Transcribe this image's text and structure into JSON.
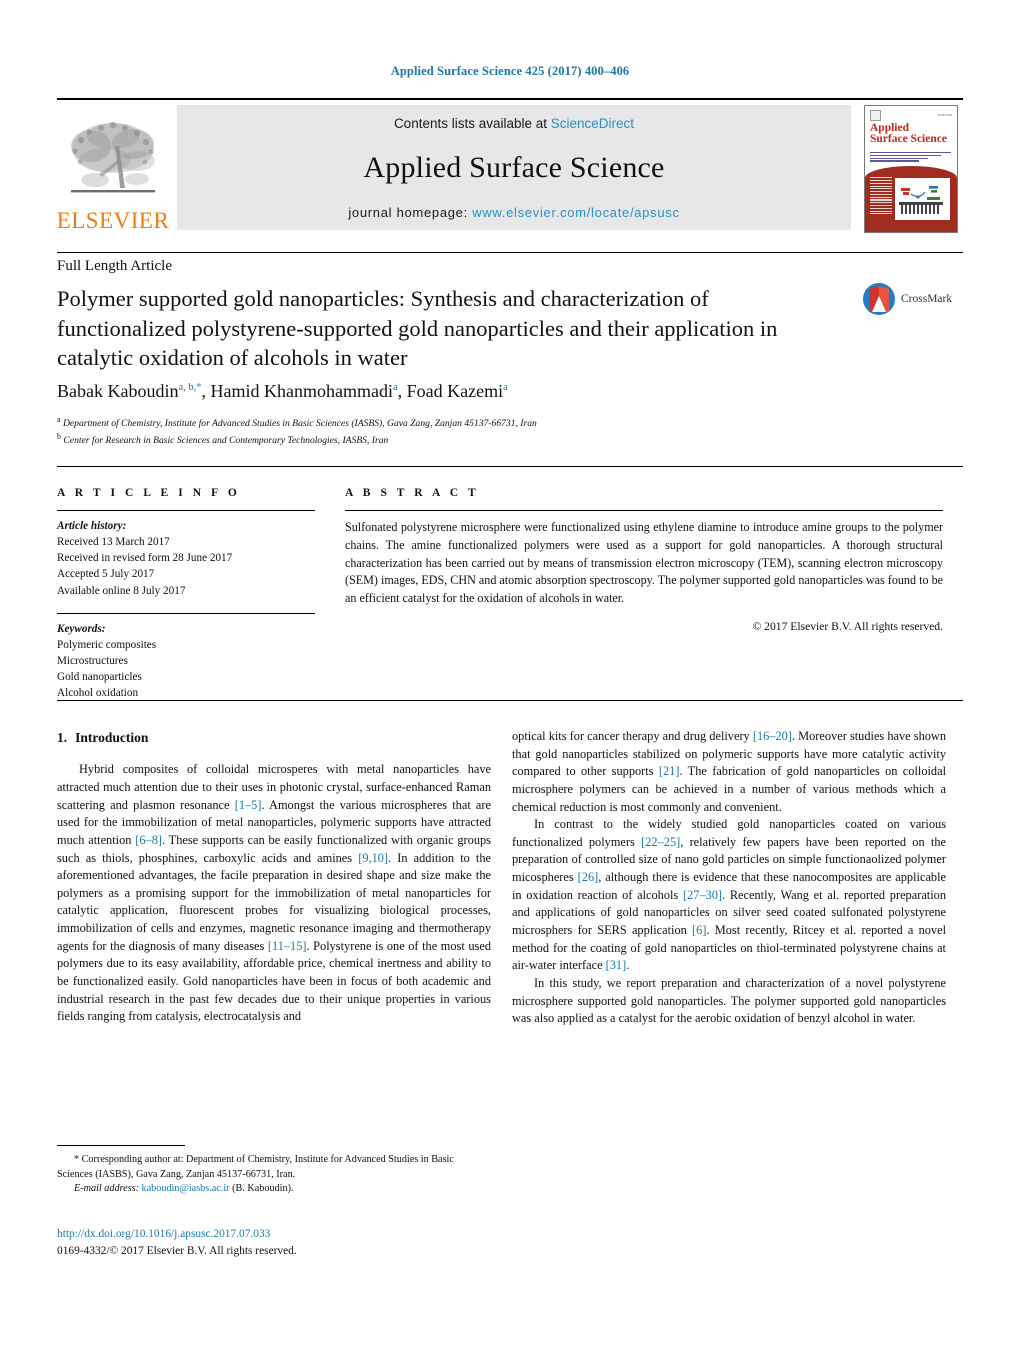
{
  "running_head": "Applied Surface Science 425 (2017) 400–406",
  "masthead": {
    "contents_prefix": "Contents lists available at ",
    "contents_link": "ScienceDirect",
    "journal_name": "Applied Surface Science",
    "homepage_prefix": "journal homepage: ",
    "homepage_link": "www.elsevier.com/locate/apsusc",
    "publisher_wordmark": "ELSEVIER",
    "cover": {
      "title_line1": "Applied",
      "title_line2": "Surface Science",
      "publisher_small": "ELSEVIER"
    }
  },
  "article": {
    "type": "Full Length Article",
    "title": "Polymer supported gold nanoparticles: Synthesis and characterization of functionalized polystyrene-supported gold nanoparticles and their application in catalytic oxidation of alcohols in water",
    "crossmark_label": "CrossMark",
    "authors": [
      {
        "name": "Babak Kaboudin",
        "marks": "a, b,*"
      },
      {
        "name": "Hamid Khanmohammadi",
        "marks": "a"
      },
      {
        "name": "Foad Kazemi",
        "marks": "a"
      }
    ],
    "affiliations": [
      {
        "mark": "a",
        "text": "Department of Chemistry, Institute for Advanced Studies in Basic Sciences (IASBS), Gava Zang, Zanjan 45137-66731, Iran"
      },
      {
        "mark": "b",
        "text": "Center for Research in Basic Sciences and Contemporary Technologies, IASBS, Iran"
      }
    ]
  },
  "article_info": {
    "heading": "A R T I C L E   I N F O",
    "history_label": "Article history:",
    "history": [
      "Received 13 March 2017",
      "Received in revised form 28 June 2017",
      "Accepted 5 July 2017",
      "Available online 8 July 2017"
    ],
    "keywords_label": "Keywords:",
    "keywords": [
      "Polymeric composites",
      "Microstructures",
      "Gold nanoparticles",
      "Alcohol oxidation"
    ]
  },
  "abstract": {
    "heading": "A B S T R A C T",
    "text": "Sulfonated polystyrene microsphere were functionalized using ethylene diamine to introduce amine groups to the polymer chains. The amine functionalized polymers were used as a support for gold nanoparticles. A thorough structural characterization has been carried out by means of transmission electron microscopy (TEM), scanning electron microscopy (SEM) images, EDS, CHN and atomic absorption spectroscopy. The polymer supported gold nanoparticles was found to be an efficient catalyst for the oxidation of alcohols in water.",
    "copyright": "© 2017 Elsevier B.V. All rights reserved."
  },
  "body": {
    "section_number": "1.",
    "section_title": "Introduction",
    "left_paragraph_1_part1": "Hybrid composites of colloidal microsperes with metal nanoparticles have attracted much attention due to their uses in photonic crystal, surface-enhanced Raman scattering and plasmon resonance ",
    "ref_1_5": "[1–5]",
    "left_paragraph_1_part2": ". Amongst the various microspheres that are used for the immobilization of metal nanoparticles, polymeric supports have attracted much attention ",
    "ref_6_8": "[6–8]",
    "left_paragraph_1_part3": ". These supports can be easily functionalized with organic groups such as thiols, phosphines, carboxylic acids and amines ",
    "ref_9_10": "[9,10]",
    "left_paragraph_1_part4": ". In addition to the aforementioned advantages, the facile preparation in desired shape and size make the polymers as a promising support for the immobilization of metal nanoparticles for catalytic application, fluorescent probes for visualizing biological processes, immobilization of cells and enzymes, magnetic resonance imaging and thermotherapy agents for the diagnosis of many diseases ",
    "ref_11_15": "[11–15]",
    "left_paragraph_1_part5": ". Polystyrene is one of the most used polymers due to its easy availability, affordable price, chemical inertness and ability to be functionalized easily. Gold nanoparticles have been in focus of both academic and industrial research in the past few decades due to their unique properties in various fields ranging from catalysis, electrocatalysis and ",
    "right_paragraph_1_part1": "optical kits for cancer therapy and drug delivery ",
    "ref_16_20": "[16–20]",
    "right_paragraph_1_part2": ". Moreover studies have shown that gold nanoparticles stabilized on polymeric supports have more catalytic activity compared to other supports ",
    "ref_21": "[21]",
    "right_paragraph_1_part3": ". The fabrication of gold nanoparticles on colloidal microsphere polymers can be achieved in a number of various methods which a chemical reduction is most commonly and convenient.",
    "right_paragraph_2_part1": "In contrast to the widely studied gold nanoparticles coated on various functionalized polymers ",
    "ref_22_25": "[22–25]",
    "right_paragraph_2_part2": ", relatively few papers have been reported on the preparation of controlled size of nano gold particles on simple functionaolized polymer micospheres ",
    "ref_26": "[26]",
    "right_paragraph_2_part3": ", although there is evidence that these nanocomposites are applicable in oxidation reaction of alcohols ",
    "ref_27_30": "[27–30]",
    "right_paragraph_2_part4": ". Recently, Wang et al. reported preparation and applications of gold nanoparticles on silver seed coated sulfonated polystyrene microsphers for SERS application ",
    "ref_6": "[6]",
    "right_paragraph_2_part5": ". Most recently, Ritcey et al. reported a novel method for the coating of gold nanoparticles on thiol-terminated polystyrene chains at air-water interface ",
    "ref_31": "[31]",
    "right_paragraph_2_part6": ".",
    "right_paragraph_3": "In this study, we report preparation and characterization of a novel polystyrene microsphere supported gold nanoparticles. The polymer supported gold nanoparticles was also applied as a catalyst for the aerobic oxidation of benzyl alcohol in water."
  },
  "footnotes": {
    "corresponding": "* Corresponding author at: Department of Chemistry, Institute for Advanced Studies in Basic Sciences (IASBS), Gava Zang, Zanjan 45137-66731, Iran.",
    "email_label": "E-mail address:",
    "email": "kaboudin@iasbs.ac.ir",
    "email_suffix": "(B. Kaboudin).",
    "doi": "http://dx.doi.org/10.1016/j.apsusc.2017.07.033",
    "issn_line": "0169-4332/© 2017 Elsevier B.V. All rights reserved."
  },
  "colors": {
    "link": "#1a7aa8",
    "masthead_link": "#2a90c8",
    "elsevier_orange": "#f07d12",
    "cover_red": "#a02c20",
    "band_gray": "#e7e7e8"
  }
}
